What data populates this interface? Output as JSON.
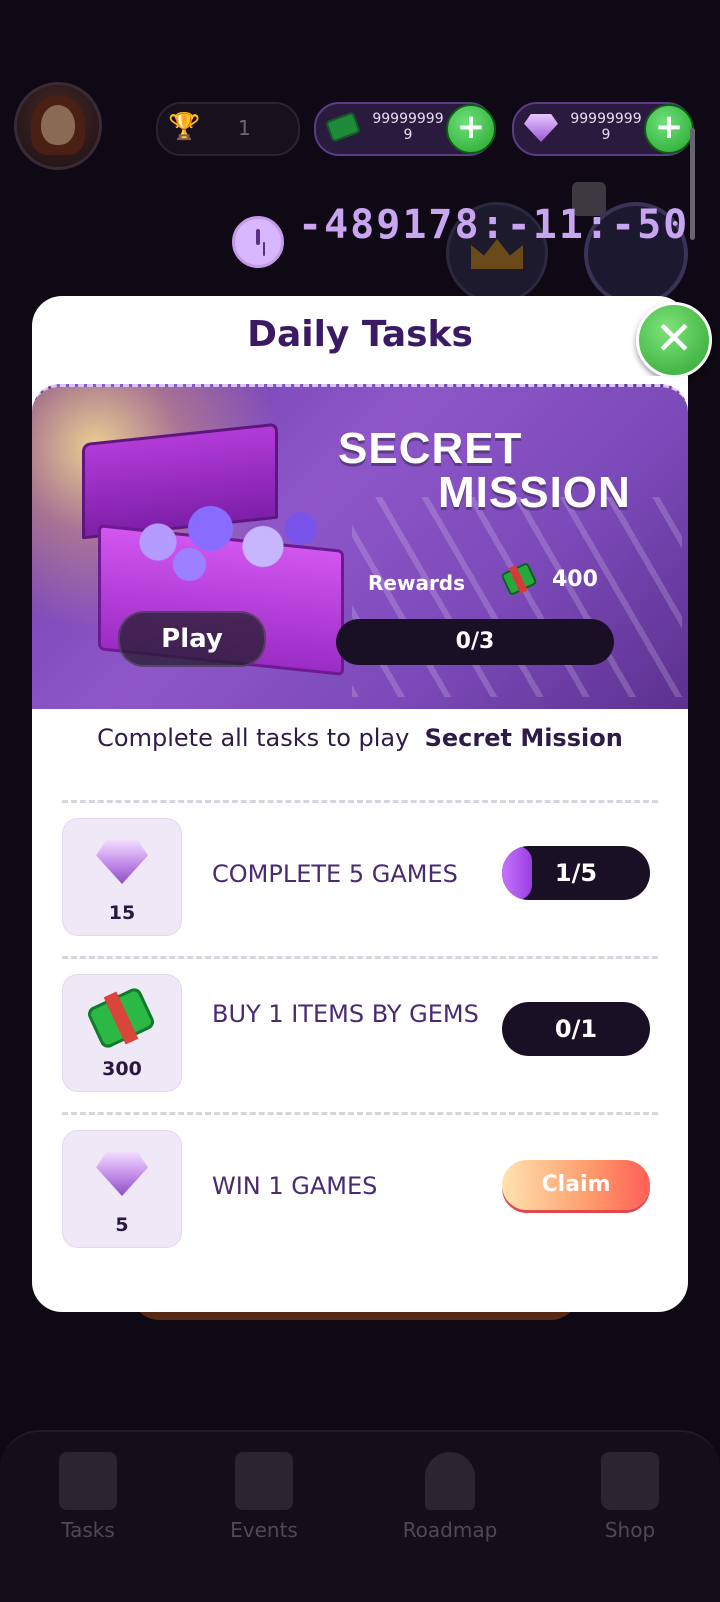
{
  "header": {
    "trophy_count": "1",
    "cash_value": "999999999",
    "gem_value": "999999999",
    "timer": "-489178:-11:-50"
  },
  "modal": {
    "title": "Daily Tasks",
    "banner": {
      "title_line1": "SECRET",
      "title_line2": "MISSION",
      "rewards_label": "Rewards",
      "rewards_value": "400",
      "play_label": "Play",
      "progress": "0/3"
    },
    "instruction_prefix": "Complete all tasks to play",
    "instruction_bold": "Secret Mission",
    "tasks": [
      {
        "reward_icon": "gem-icon",
        "reward": "15",
        "label": "COMPLETE 5 GAMES",
        "status": "1/5",
        "progress_fraction": 0.2
      },
      {
        "reward_icon": "cash-icon",
        "reward": "300",
        "label": "BUY 1 ITEMS BY GEMS",
        "status": "0/1",
        "progress_fraction": 0
      },
      {
        "reward_icon": "gem-icon",
        "reward": "5",
        "label": "WIN 1 GAMES",
        "status": "Claim",
        "progress_fraction": 1
      }
    ]
  },
  "bottom_nav": {
    "tasks": "Tasks",
    "events": "Events",
    "roadmap": "Roadmap",
    "shop": "Shop"
  },
  "colors": {
    "accent_purple": "#3c1a63",
    "progress_fill": "#c773ff",
    "claim_gradient_end": "#ff5e58",
    "close_green": "#2da531"
  }
}
